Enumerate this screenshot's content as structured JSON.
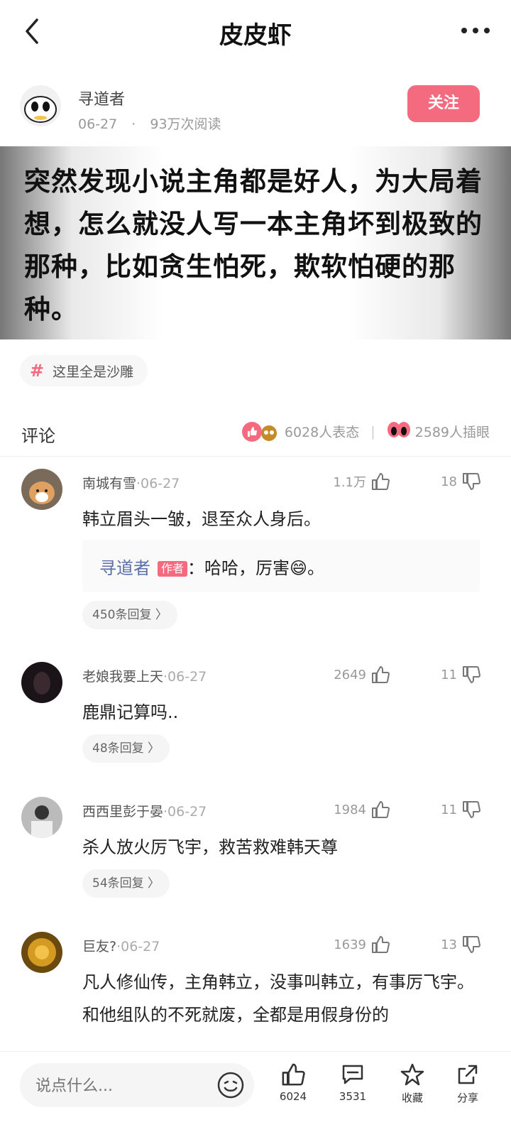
{
  "header": {
    "title": "皮皮虾"
  },
  "author": {
    "name": "寻道者",
    "date": "06-27",
    "separator": "·",
    "reads": "93万次阅读",
    "follow_label": "关注"
  },
  "post": {
    "text": "突然发现小说主角都是好人，为大局着想，怎么就没人写一本主角坏到极致的那种，比如贪生怕死，欺软怕硬的那种。"
  },
  "tag": {
    "hash": "#",
    "label": "这里全是沙雕"
  },
  "comments_header": {
    "title": "评论",
    "reactions": "6028人表态",
    "divider": "|",
    "eyes": "2589人插眼"
  },
  "comments": [
    {
      "name": "南城有雪",
      "date": "·06-27",
      "likes": "1.1万",
      "dislikes": "18",
      "text": "韩立眉头一皱，退至众人身后。",
      "reply": {
        "name": "寻道者",
        "badge": "作者",
        "text": "：哈哈，厉害😄。"
      },
      "reply_count": "450条回复 〉"
    },
    {
      "name": "老娘我要上天",
      "date": "·06-27",
      "likes": "2649",
      "dislikes": "11",
      "text": "鹿鼎记算吗..",
      "reply_count": "48条回复 〉"
    },
    {
      "name": "西西里彭于晏",
      "date": "·06-27",
      "likes": "1984",
      "dislikes": "11",
      "text": "杀人放火厉飞宇，救苦救难韩天尊",
      "reply_count": "54条回复 〉"
    },
    {
      "name": "巨友?",
      "date": "·06-27",
      "likes": "1639",
      "dislikes": "13",
      "text": "凡人修仙传，主角韩立，没事叫韩立，有事厉飞宇。和他组队的不死就废，全都是用假身份的"
    }
  ],
  "bottom": {
    "input_placeholder": "说点什么...",
    "like_count": "6024",
    "comment_count": "3531",
    "favorite_label": "收藏",
    "share_label": "分享"
  }
}
